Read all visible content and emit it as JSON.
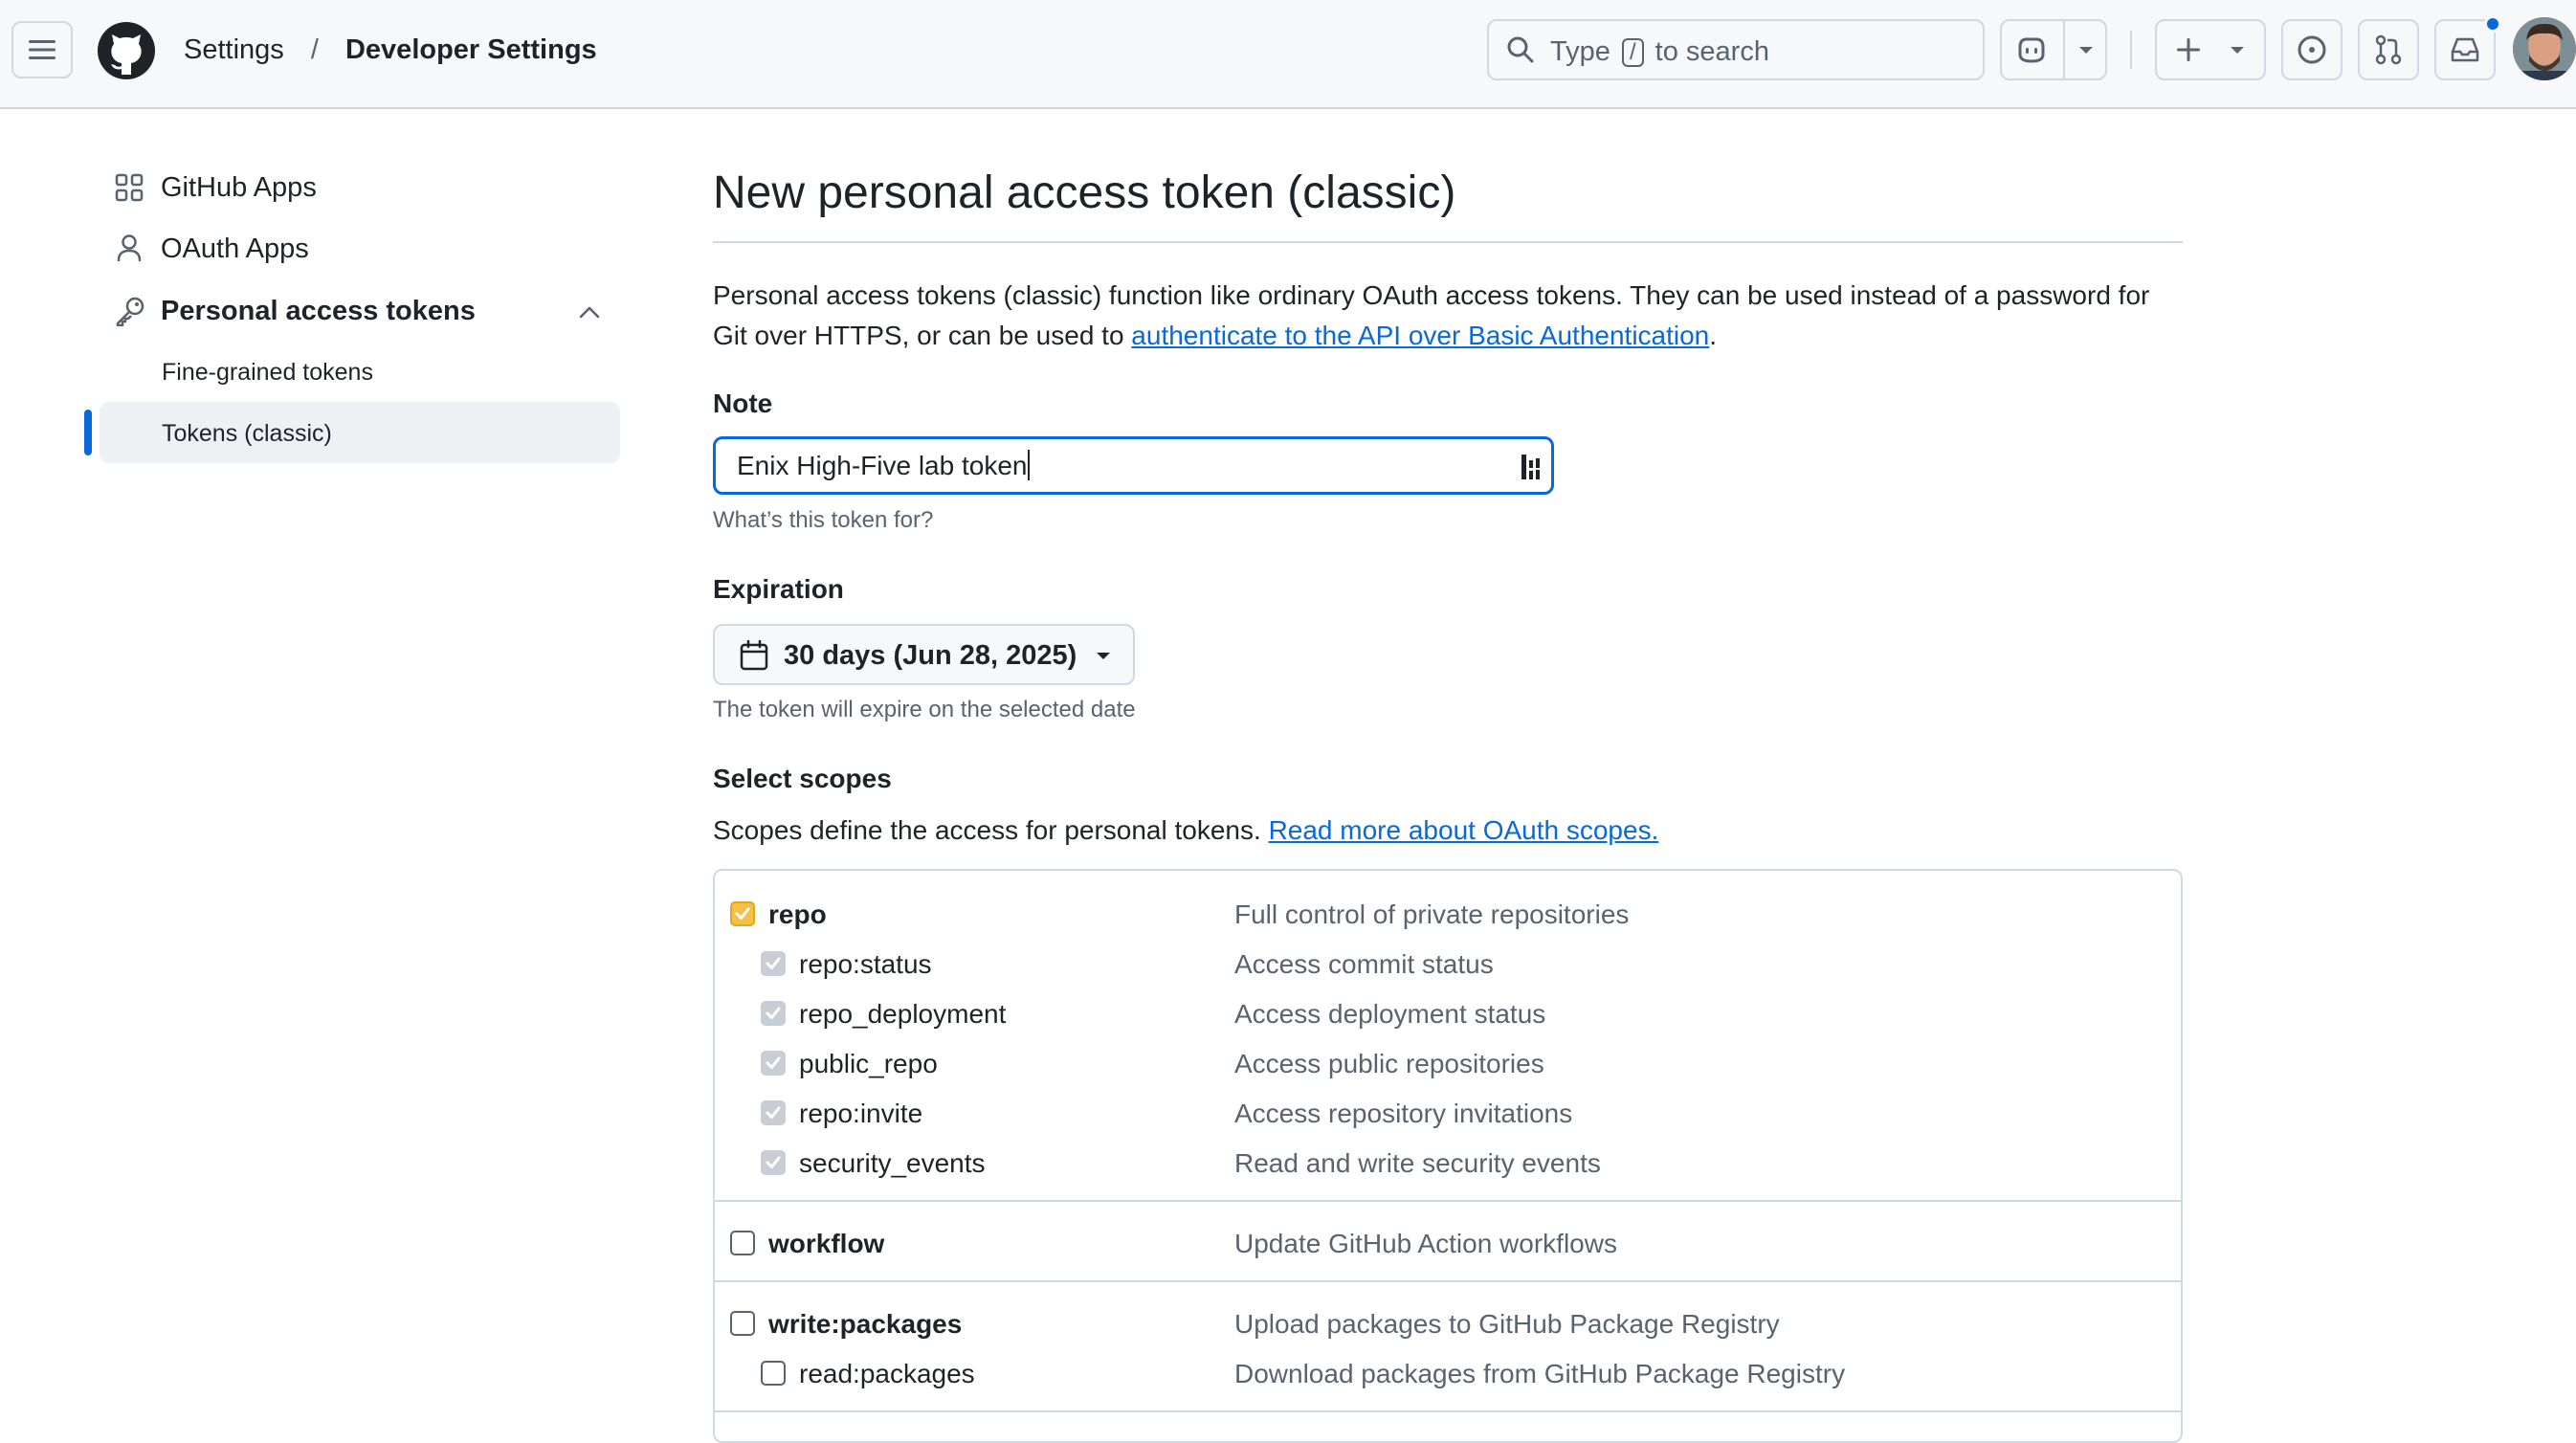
{
  "header": {
    "breadcrumb_root": "Settings",
    "breadcrumb_separator": "/",
    "breadcrumb_current": "Developer Settings",
    "search": {
      "prefix": "Type",
      "key": "/",
      "suffix": "to search"
    }
  },
  "sidebar": {
    "items": [
      {
        "label": "GitHub Apps",
        "icon": "apps-grid-icon"
      },
      {
        "label": "OAuth Apps",
        "icon": "person-icon"
      },
      {
        "label": "Personal access tokens",
        "icon": "key-icon",
        "expanded": true
      }
    ],
    "sub_items": [
      {
        "label": "Fine-grained tokens",
        "active": false
      },
      {
        "label": "Tokens (classic)",
        "active": true
      }
    ]
  },
  "main": {
    "title": "New personal access token (classic)",
    "intro_text": "Personal access tokens (classic) function like ordinary OAuth access tokens. They can be used instead of a password for Git over HTTPS, or can be used to ",
    "intro_link": "authenticate to the API over Basic Authentication",
    "intro_end": ".",
    "note": {
      "label": "Note",
      "value": "Enix High-Five lab token",
      "hint": "What’s this token for?"
    },
    "expiration": {
      "label": "Expiration",
      "value": "30 days (Jun 28, 2025)",
      "hint": "The token will expire on the selected date"
    },
    "scopes": {
      "label": "Select scopes",
      "description": "Scopes define the access for personal tokens. ",
      "link": "Read more about OAuth scopes.",
      "rows": [
        {
          "name": "repo",
          "desc": "Full control of private repositories",
          "checked": true,
          "child": false
        },
        {
          "name": "repo:status",
          "desc": "Access commit status",
          "checked": true,
          "child": true
        },
        {
          "name": "repo_deployment",
          "desc": "Access deployment status",
          "checked": true,
          "child": true
        },
        {
          "name": "public_repo",
          "desc": "Access public repositories",
          "checked": true,
          "child": true
        },
        {
          "name": "repo:invite",
          "desc": "Access repository invitations",
          "checked": true,
          "child": true
        },
        {
          "name": "security_events",
          "desc": "Read and write security events",
          "checked": true,
          "child": true
        },
        {
          "name": "workflow",
          "desc": "Update GitHub Action workflows",
          "checked": false,
          "child": false
        },
        {
          "name": "write:packages",
          "desc": "Upload packages to GitHub Package Registry",
          "checked": false,
          "child": false
        },
        {
          "name": "read:packages",
          "desc": "Download packages from GitHub Package Registry",
          "checked": false,
          "child": true
        }
      ]
    }
  },
  "colors": {
    "accent": "#0969da",
    "checkbox_checked": "#f4c146",
    "checkbox_dimmed": "#c9ced4",
    "notification_dot": "#0969da"
  }
}
